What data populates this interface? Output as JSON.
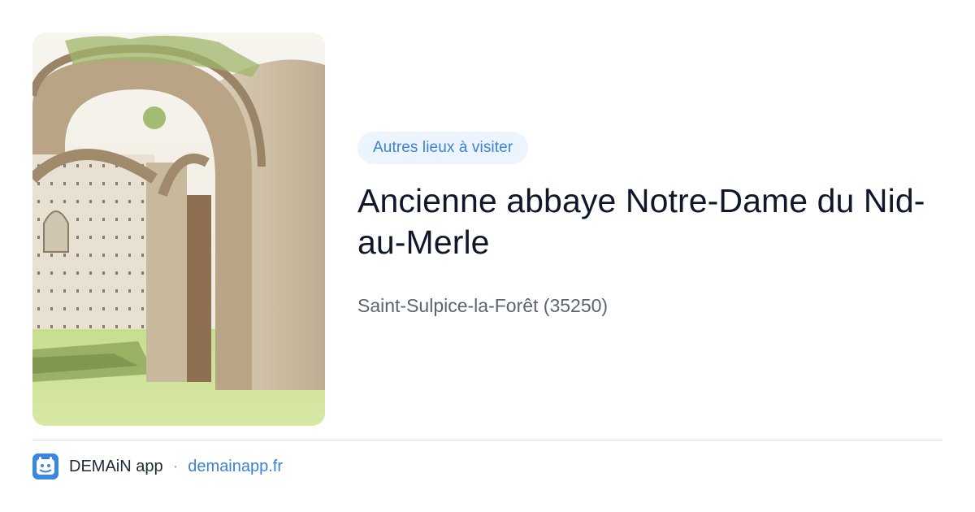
{
  "category": "Autres lieux à visiter",
  "place": {
    "title": "Ancienne abbaye Notre-Dame du Nid-au-Merle",
    "location": "Saint-Sulpice-la-Forêt (35250)"
  },
  "photo": {
    "subject": "ruined abbey stone arches on green lawn"
  },
  "footer": {
    "app_icon": "demain-app-logo-icon",
    "app_name": "DEMAiN app",
    "separator": "·",
    "site": "demainapp.fr"
  },
  "colors": {
    "accent": "#3b82d6",
    "pill_bg": "#ecf4fd",
    "title": "#0f172a",
    "muted": "#5b6470",
    "divider": "#dfe3e8",
    "app_icon_bg": "#3b86e0"
  }
}
